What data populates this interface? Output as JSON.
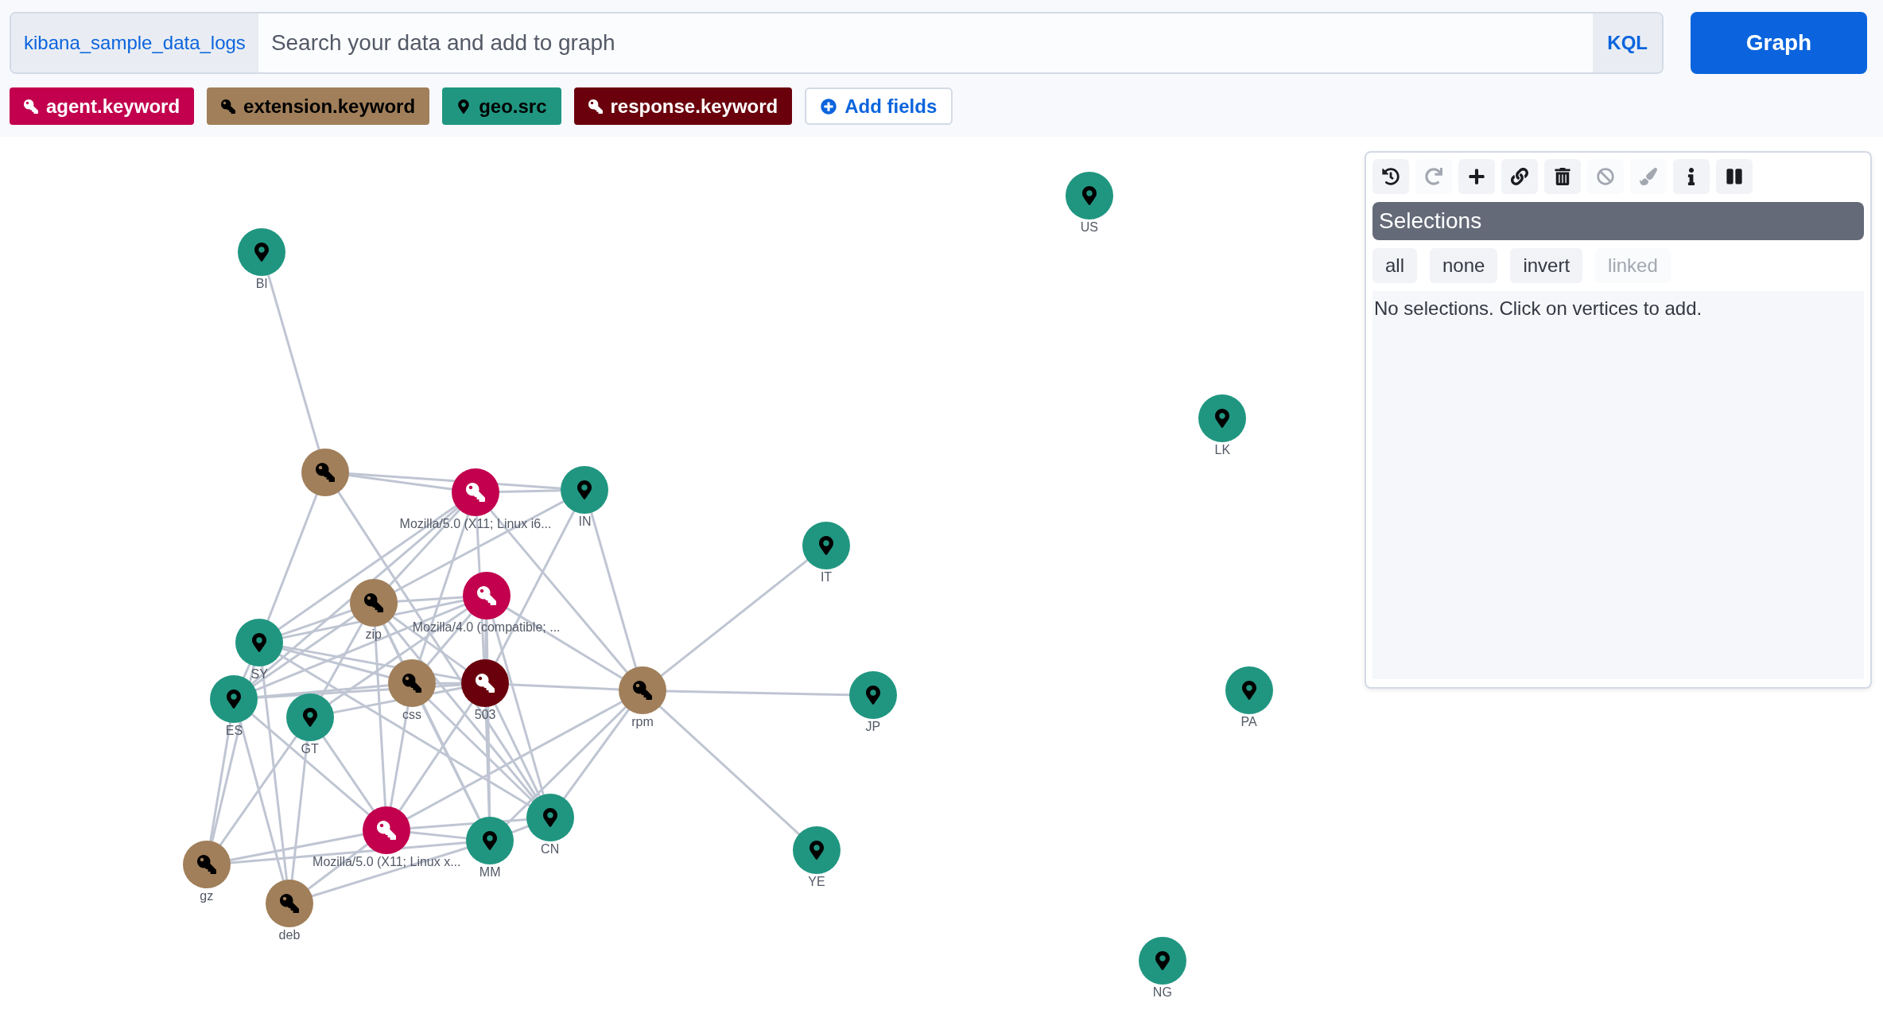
{
  "index_pattern": "kibana_sample_data_logs",
  "search": {
    "placeholder": "Search your data and add to graph"
  },
  "query_language": "KQL",
  "graph_button": "Graph",
  "fields": [
    {
      "label": "agent.keyword",
      "kind": "keyword",
      "color": "#c2004e"
    },
    {
      "label": "extension.keyword",
      "kind": "keyword",
      "color": "#a07f5a"
    },
    {
      "label": "geo.src",
      "kind": "geo",
      "color": "#209681"
    },
    {
      "label": "response.keyword",
      "kind": "keyword",
      "color": "#6a000c"
    }
  ],
  "add_fields": "Add fields",
  "nodes": [
    {
      "label": "BI",
      "kind": "geo",
      "color": "#209681"
    },
    {
      "label": "US",
      "kind": "geo",
      "color": "#209681"
    },
    {
      "label": "LK",
      "kind": "geo",
      "color": "#209681"
    },
    {
      "label": "IT",
      "kind": "geo",
      "color": "#209681"
    },
    {
      "label": "JP",
      "kind": "geo",
      "color": "#209681"
    },
    {
      "label": "PA",
      "kind": "geo",
      "color": "#209681"
    },
    {
      "label": "YE",
      "kind": "geo",
      "color": "#209681"
    },
    {
      "label": "NG",
      "kind": "geo",
      "color": "#209681"
    },
    {
      "kind": "keyword",
      "color": "#a07f5a"
    },
    {
      "label": "Mozilla/5.0 (X11; Linux i6...",
      "kind": "keyword",
      "color": "#c2004e"
    },
    {
      "label": "IN",
      "kind": "geo",
      "color": "#209681"
    },
    {
      "label": "zip",
      "kind": "keyword",
      "color": "#a07f5a"
    },
    {
      "label": "Mozilla/4.0 (compatible; ...",
      "kind": "keyword",
      "color": "#c2004e"
    },
    {
      "label": "SY",
      "kind": "geo",
      "color": "#209681"
    },
    {
      "label": "ES",
      "kind": "geo",
      "color": "#209681"
    },
    {
      "label": "GT",
      "kind": "geo",
      "color": "#209681"
    },
    {
      "label": "css",
      "kind": "keyword",
      "color": "#a07f5a"
    },
    {
      "label": "503",
      "kind": "keyword",
      "color": "#6a000c"
    },
    {
      "label": "rpm",
      "kind": "keyword",
      "color": "#a07f5a"
    },
    {
      "label": "Mozilla/5.0 (X11; Linux x...",
      "kind": "keyword",
      "color": "#c2004e"
    },
    {
      "label": "MM",
      "kind": "geo",
      "color": "#209681"
    },
    {
      "label": "CN",
      "kind": "geo",
      "color": "#209681"
    },
    {
      "label": "gz",
      "kind": "keyword",
      "color": "#a07f5a"
    },
    {
      "label": "deb",
      "kind": "keyword",
      "color": "#a07f5a"
    }
  ],
  "panel": {
    "toolbar": [
      {
        "kind": "undo",
        "disabled": false
      },
      {
        "kind": "redo",
        "disabled": true
      },
      {
        "kind": "add",
        "disabled": false
      },
      {
        "kind": "link",
        "disabled": false
      },
      {
        "kind": "delete",
        "disabled": false
      },
      {
        "kind": "blocklist",
        "disabled": true
      },
      {
        "kind": "style",
        "disabled": true
      },
      {
        "kind": "info",
        "disabled": false
      },
      {
        "kind": "pause",
        "disabled": false
      }
    ],
    "title": "Selections",
    "selection_buttons": [
      {
        "label": "all",
        "disabled": false
      },
      {
        "label": "none",
        "disabled": false
      },
      {
        "label": "invert",
        "disabled": false
      },
      {
        "label": "linked",
        "disabled": true
      }
    ],
    "message": "No selections. Click on vertices to add."
  }
}
